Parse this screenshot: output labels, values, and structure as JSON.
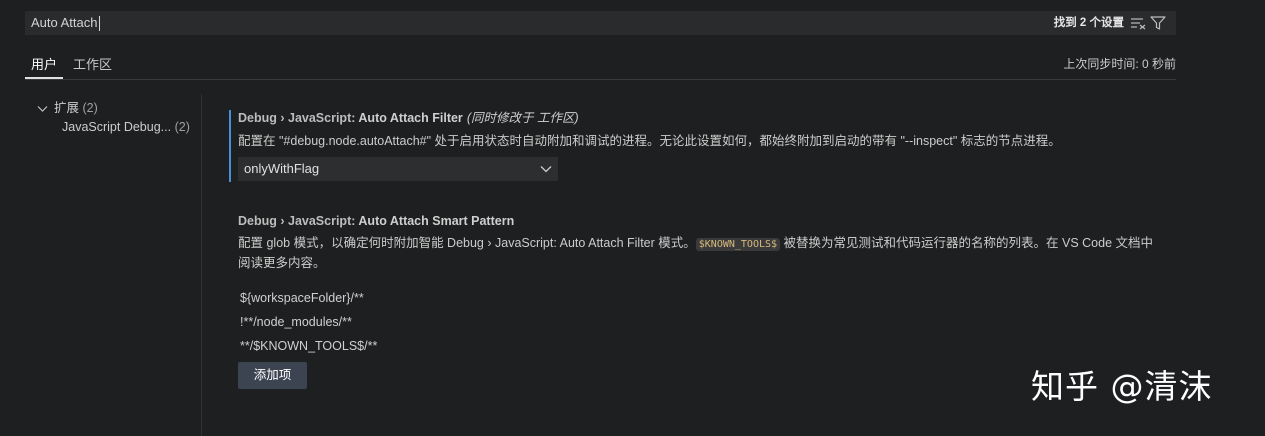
{
  "search": {
    "query": "Auto Attach",
    "result_count": "找到 2 个设置",
    "clear_icon": "clear-filter-icon",
    "filter_icon": "filter-icon"
  },
  "tabs": [
    {
      "label": "用户",
      "active": true
    },
    {
      "label": "工作区",
      "active": false
    }
  ],
  "sync_status": "上次同步时间: 0 秒前",
  "toc": {
    "group_label": "扩展",
    "group_count": "(2)",
    "items": [
      {
        "label": "JavaScript Debug...",
        "count": "(2)"
      }
    ]
  },
  "settings": [
    {
      "category": "Debug › JavaScript: ",
      "name": "Auto Attach Filter",
      "modified_note": "(同时修改于 工作区)",
      "description": "配置在 \"#debug.node.autoAttach#\" 处于启用状态时自动附加和调试的进程。无论此设置如何，都始终附加到启动的带有 \"--inspect\" 标志的节点进程。",
      "value": "onlyWithFlag"
    },
    {
      "category": "Debug › JavaScript: ",
      "name": "Auto Attach Smart Pattern",
      "description_before": "配置 glob 模式，以确定何时附加智能 Debug › JavaScript: Auto Attach Filter 模式。",
      "description_code": "$KNOWN_TOOLS$",
      "description_after": " 被替换为常见测试和代码运行器的名称的列表。在 VS Code 文档中阅读更多内容。",
      "patterns": [
        "${workspaceFolder}/**",
        "!**/node_modules/**",
        "**/$KNOWN_TOOLS$/**"
      ],
      "add_button": "添加项"
    }
  ],
  "watermark": "知乎 @清沫",
  "colors": {
    "background": "#1e1f20",
    "focus_bar": "#4a8fd6",
    "button": "#3c4452",
    "code_token": "#d7ba7d"
  }
}
